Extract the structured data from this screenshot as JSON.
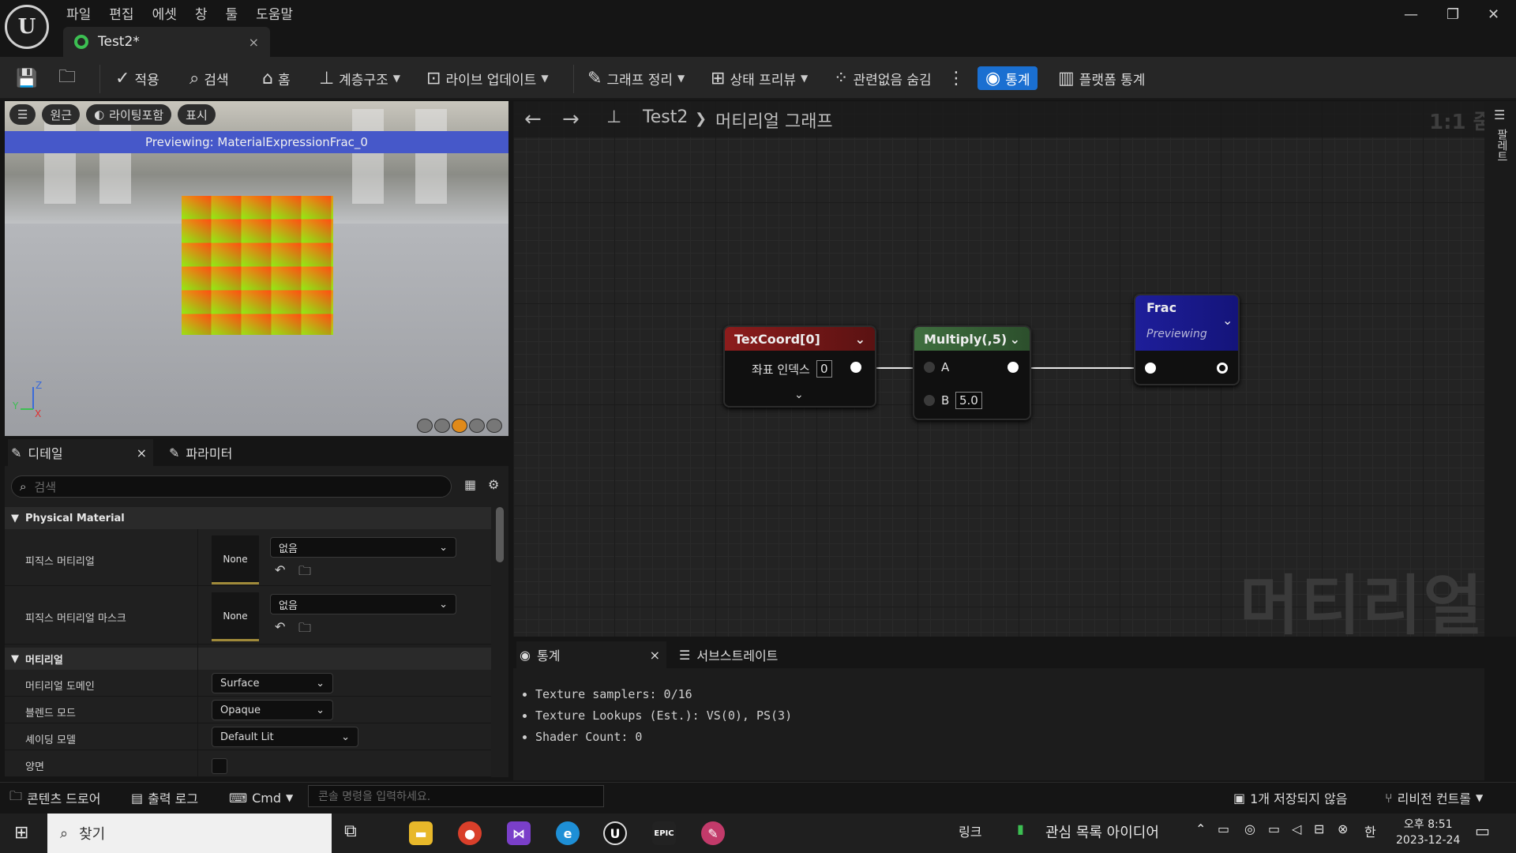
{
  "menu": [
    "파일",
    "편집",
    "에셋",
    "창",
    "툴",
    "도움말"
  ],
  "tab": {
    "title": "Test2*",
    "close": "×"
  },
  "window": {
    "min": "—",
    "max": "❐",
    "close": "✕"
  },
  "toolbar": {
    "apply": "적용",
    "search": "검색",
    "home": "홈",
    "hierarchy": "계층구조",
    "live_update": "라이브 업데이트",
    "graph_tidy": "그래프 정리",
    "state_preview": "상태 프리뷰",
    "hide_unrelated": "관련없음 숨김",
    "stats": "통계",
    "platform_stats": "플랫폼 통계"
  },
  "viewport": {
    "perspective": "원근",
    "lighting": "라이팅포함",
    "show": "표시",
    "preview_text": "Previewing: MaterialExpressionFrac_0"
  },
  "details": {
    "tab_details": "디테일",
    "tab_params": "파라미터",
    "close": "×",
    "search_placeholder": "검색",
    "cat_physical": "Physical Material",
    "phys_material": "피직스 머티리얼",
    "phys_mask": "피직스 머티리얼 마스크",
    "none": "None",
    "empty": "없음",
    "cat_material": "머티리얼",
    "domain_label": "머티리얼 도메인",
    "domain_value": "Surface",
    "blend_label": "블렌드 모드",
    "blend_value": "Opaque",
    "shading_label": "셰이딩 모델",
    "shading_value": "Default Lit",
    "twosided_label": "양면"
  },
  "graph": {
    "crumb_root": "Test2",
    "crumb_sep": "❯",
    "crumb_leaf": "머티리얼 그래프",
    "zoom": "1:1 줌",
    "watermark": "머티리얼",
    "palette": "팔레트",
    "node_texcoord": {
      "title": "TexCoord[0]",
      "pin_label": "좌표 인덱스",
      "value": "0"
    },
    "node_multiply": {
      "title": "Multiply(,5)",
      "pin_a": "A",
      "pin_b": "B",
      "value_b": "5.0"
    },
    "node_frac": {
      "title": "Frac",
      "subtitle": "Previewing"
    }
  },
  "stats": {
    "tab_stats": "통계",
    "tab_substrate": "서브스트레이트",
    "close": "×",
    "lines": [
      "Texture samplers: 0/16",
      "Texture Lookups (Est.): VS(0), PS(3)",
      "Shader Count: 0"
    ]
  },
  "statusbar": {
    "content_drawer": "콘텐츠 드로어",
    "output_log": "출력 로그",
    "cmd": "Cmd",
    "cmd_placeholder": "콘솔 명령을 입력하세요.",
    "unsaved": "1개 저장되지 않음",
    "revision": "리비전 컨트롤"
  },
  "taskbar": {
    "search": "찾기",
    "link": "링크",
    "watchlist": "관심 목록 아이디어",
    "ime": "한",
    "time": "오후 8:51",
    "date": "2023-12-24"
  },
  "colors": {
    "texcoord_head": "#8c1c1c",
    "multiply_head": "#3f6f3f",
    "frac_head": "#1e1e9a",
    "accent": "#1a6fd1"
  }
}
